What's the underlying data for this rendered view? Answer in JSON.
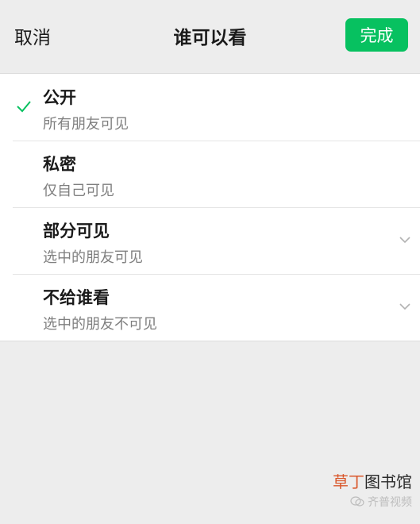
{
  "nav": {
    "cancel_label": "取消",
    "title": "谁可以看",
    "done_label": "完成"
  },
  "options": [
    {
      "title": "公开",
      "subtitle": "所有朋友可见",
      "selected": true
    },
    {
      "title": "私密",
      "subtitle": "仅自己可见",
      "selected": false
    },
    {
      "title": "部分可见",
      "subtitle": "选中的朋友可见",
      "expandable": true
    },
    {
      "title": "不给谁看",
      "subtitle": "选中的朋友不可见",
      "expandable": true
    }
  ],
  "watermark": {
    "brand_accent": "草丁",
    "brand_rest": "图书馆",
    "sub": "齐普视频"
  },
  "colors": {
    "accent": "#07c160",
    "background": "#ededed"
  }
}
